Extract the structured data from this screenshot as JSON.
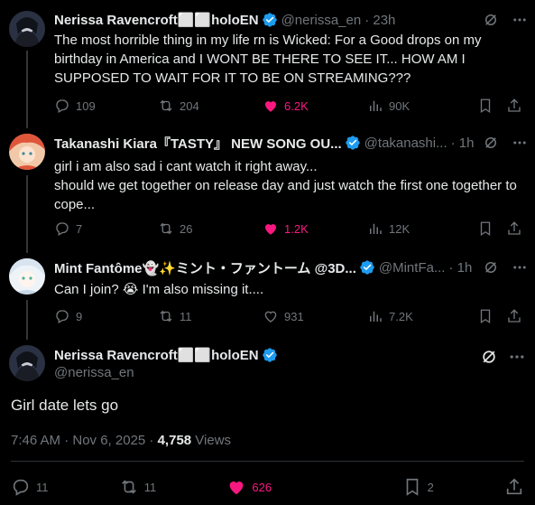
{
  "tweets": [
    {
      "name": "Nerissa Ravencroft⬜⬜holoEN",
      "handle": "@nerissa_en",
      "time": "· 23h",
      "text": "The most horrible thing in my life rn is Wicked: For a Good drops on my birthday in America and I WONT BE THERE TO SEE IT... HOW AM I SUPPOSED TO WAIT FOR IT TO BE ON STREAMING???",
      "replies": "109",
      "reposts": "204",
      "likes": "6.2K",
      "views": "90K",
      "liked": true,
      "avatar_color": "#2a3142"
    },
    {
      "name": "Takanashi Kiara『TASTY』 NEW SONG OU...",
      "handle": "@takanashi...",
      "time": "· 1h",
      "text": "girl i am also sad i cant watch it right away...\nshould we get together on release day and just watch the first one together to cope...",
      "replies": "7",
      "reposts": "26",
      "likes": "1.2K",
      "views": "12K",
      "liked": true,
      "avatar_color": "#e0563a"
    },
    {
      "name": "Mint Fantôme👻✨ミント・ファントーム @3D...",
      "handle": "@MintFa...",
      "time": "· 1h",
      "text": "Can I join? 😭 I'm also missing it....",
      "replies": "9",
      "reposts": "11",
      "likes": "931",
      "views": "7.2K",
      "liked": false,
      "avatar_color": "#d8e4ef"
    }
  ],
  "main": {
    "name": "Nerissa Ravencroft⬜⬜holoEN",
    "handle": "@nerissa_en",
    "text": "Girl date lets go",
    "timestamp": "7:46 AM · Nov 6, 2025 · ",
    "views_count": "4,758",
    "views_label": " Views",
    "replies": "11",
    "reposts": "11",
    "likes": "626",
    "bookmarks": "2"
  },
  "colors": {
    "background": "#000000",
    "text": "#e7e9ea",
    "muted": "#71767b",
    "like": "#f91880",
    "verified": "#1d9bf0"
  }
}
